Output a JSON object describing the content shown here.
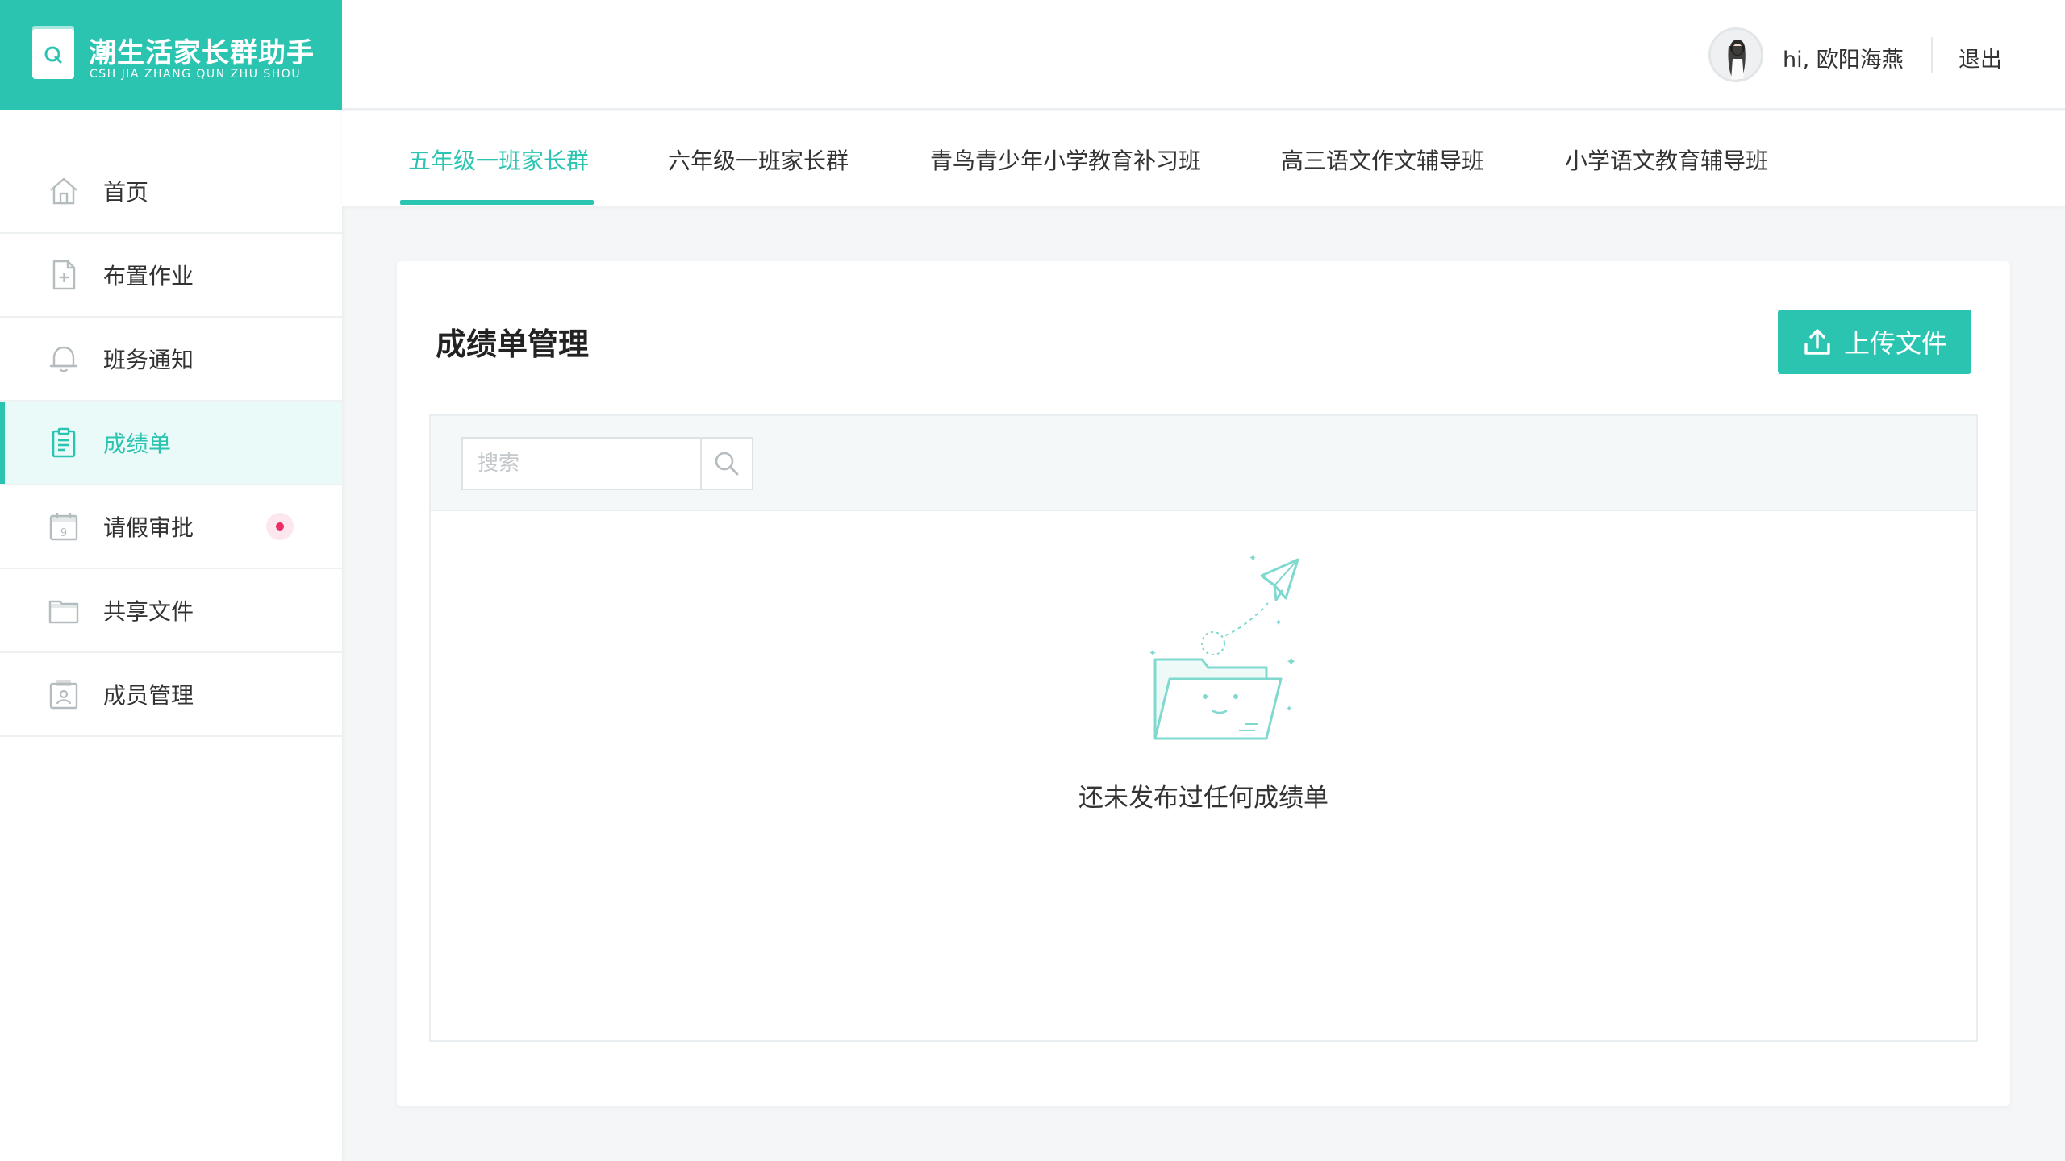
{
  "app": {
    "title": "潮生活家长群助手",
    "subtitle": "CSH JIA ZHANG QUN ZHU SHOU",
    "brand_color": "#2bc4b1"
  },
  "header": {
    "greeting": "hi, 欧阳海燕",
    "logout_label": "退出"
  },
  "sidebar": {
    "items": [
      {
        "label": "首页",
        "icon": "home-icon"
      },
      {
        "label": "布置作业",
        "icon": "document-add-icon"
      },
      {
        "label": "班务通知",
        "icon": "bell-icon"
      },
      {
        "label": "成绩单",
        "icon": "clipboard-icon",
        "active": true
      },
      {
        "label": "请假审批",
        "icon": "calendar-icon",
        "badge": true
      },
      {
        "label": "共享文件",
        "icon": "folder-icon"
      },
      {
        "label": "成员管理",
        "icon": "members-icon"
      }
    ]
  },
  "tabs": [
    {
      "label": "五年级一班家长群",
      "active": true
    },
    {
      "label": "六年级一班家长群"
    },
    {
      "label": "青鸟青少年小学教育补习班"
    },
    {
      "label": "高三语文作文辅导班"
    },
    {
      "label": "小学语文教育辅导班"
    }
  ],
  "main": {
    "title": "成绩单管理",
    "upload_label": "上传文件",
    "search_placeholder": "搜索",
    "empty_text": "还未发布过任何成绩单"
  }
}
